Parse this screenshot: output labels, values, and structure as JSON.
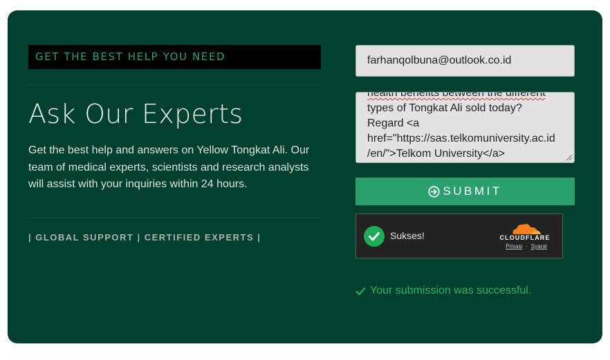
{
  "section": {
    "eyebrow": "GET THE BEST HELP YOU NEED",
    "title": "Ask Our Experts",
    "intro": "Get the best help and answers on Yellow Tongkat Ali. Our team of medical experts, scientists and research analysts will assist with your inquiries within 24 hours.",
    "tagline": "| GLOBAL SUPPORT | CERTIFIED EXPERTS |"
  },
  "form": {
    "email_value": "farhanqolbuna@outlook.co.id",
    "message_lines": [
      "health benefits between the different",
      "types of Tongkat Ali sold today?",
      "Regard <a",
      "href=\"https://sas.telkomuniversity.ac.id",
      "/en/\">Telkom University</a>"
    ],
    "submit_label": "SUBMIT",
    "success_message": "Your submission was successful."
  },
  "captcha": {
    "status": "Sukses!",
    "brand": "CLOUDFLARE",
    "privacy_link": "Privasi",
    "separator": "·",
    "terms_link": "Syarat"
  },
  "colors": {
    "panel_bg": "#01402f",
    "accent_green": "#2aa06e",
    "success_green": "#2bb566",
    "cloudflare_orange": "#f38020"
  },
  "icons": {
    "submit": "arrow-circle-right-icon",
    "captcha_status": "checkmark-circle-icon",
    "success": "checkmark-icon"
  }
}
